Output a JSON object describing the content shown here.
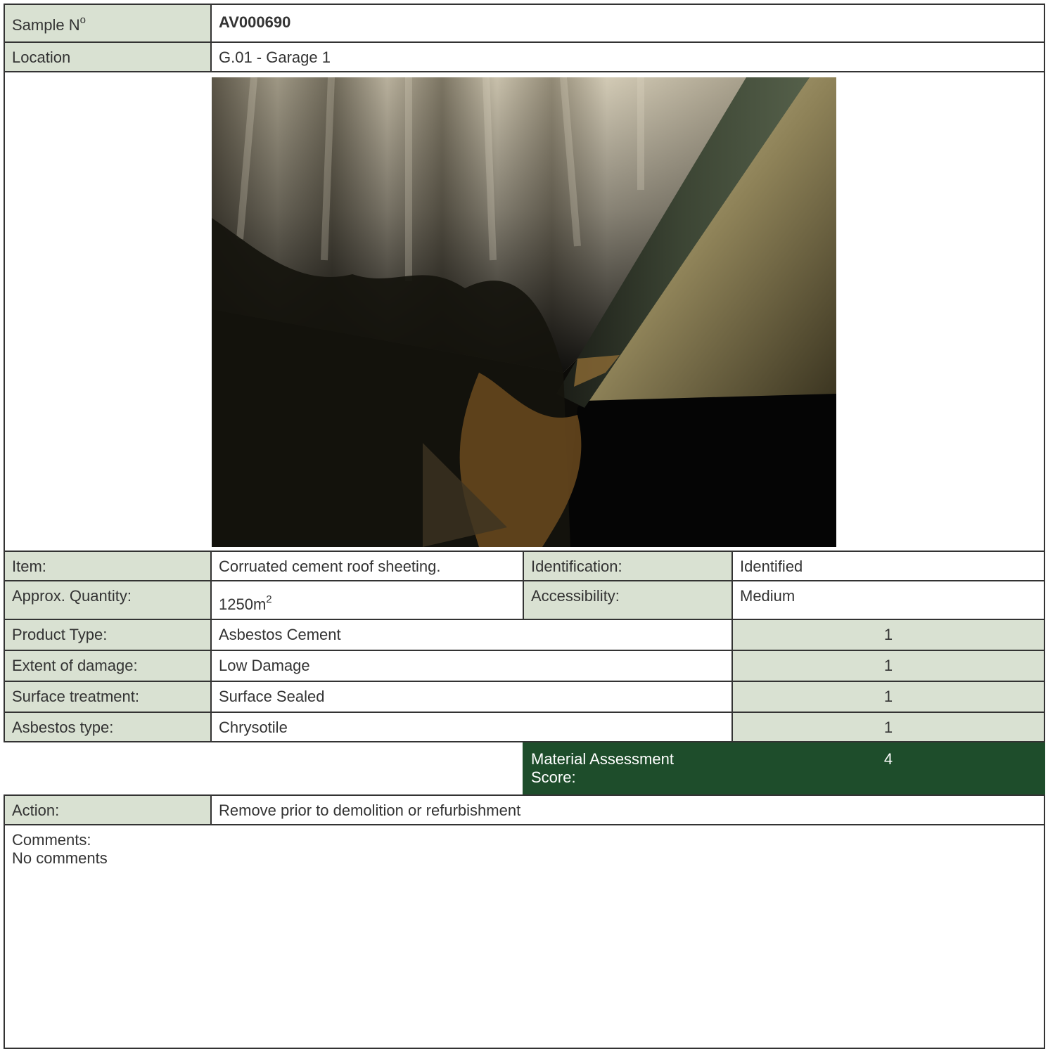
{
  "sample": {
    "label_main": "Sample N",
    "label_sup": "o",
    "value": "AV000690"
  },
  "location": {
    "label": "Location",
    "value": "G.01 - Garage 1"
  },
  "item": {
    "label": "Item:",
    "value": "Corruated cement roof sheeting."
  },
  "identification": {
    "label": "Identification:",
    "value": "Identified"
  },
  "quantity": {
    "label": "Approx. Quantity:",
    "value_main": "1250m",
    "value_sup": "2"
  },
  "accessibility": {
    "label": "Accessibility:",
    "value": "Medium"
  },
  "product_type": {
    "label": "Product Type:",
    "value": "Asbestos Cement",
    "score": "1"
  },
  "extent_damage": {
    "label": "Extent of damage:",
    "value": "Low Damage",
    "score": "1"
  },
  "surface_treatment": {
    "label": "Surface treatment:",
    "value": "Surface Sealed",
    "score": "1"
  },
  "asbestos_type": {
    "label": "Asbestos type:",
    "value": "Chrysotile",
    "score": "1"
  },
  "material_assessment": {
    "label_line1": "Material Assessment",
    "label_line2": "Score:",
    "score": "4"
  },
  "action": {
    "label": "Action:",
    "value": "Remove prior to demolition or refurbishment"
  },
  "comments": {
    "label": "Comments:",
    "value": "No comments"
  },
  "colors": {
    "label_bg": "#d9e1d2",
    "score_total_bg": "#1e4d2b",
    "border": "#333333"
  }
}
